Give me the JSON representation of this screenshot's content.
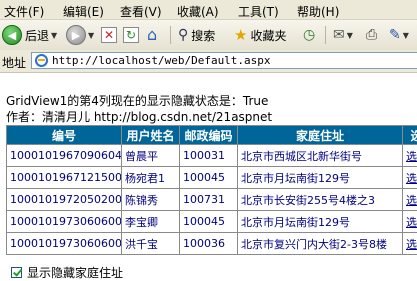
{
  "menu": {
    "items": [
      "文件(F)",
      "编辑(E)",
      "查看(V)",
      "收藏(A)",
      "工具(T)",
      "帮助(H)"
    ]
  },
  "toolbar": {
    "back_label": "后退",
    "search_label": "搜索",
    "favorites_label": "收藏夹",
    "icons": [
      "back-icon",
      "forward-icon",
      "stop-icon",
      "refresh-icon",
      "home-icon",
      "search-icon",
      "favorites-icon",
      "history-icon",
      "mail-icon",
      "print-icon"
    ]
  },
  "address": {
    "label": "地址",
    "url": "http://localhost/web/Default.aspx"
  },
  "page": {
    "status_text": "GridView1的第4列现在的显示隐藏状态是：True",
    "author_text": "作者：清清月儿 http://blog.csdn.net/21aspnet"
  },
  "grid": {
    "headers": [
      "编号",
      "用户姓名",
      "邮政编码",
      "家庭住址",
      "选"
    ],
    "rows": [
      {
        "id": "10001019670906046",
        "name": "曾晨平",
        "zip": "100031",
        "address": "北京市西城区北新华街号",
        "action": "选"
      },
      {
        "id": "10001019671215003",
        "name": "杨宛君1",
        "zip": "100045",
        "address": "北京市月坛南街129号",
        "action": "选"
      },
      {
        "id": "10001019720502000",
        "name": "陈锦秀",
        "zip": "100731",
        "address": "北京市长安街255号4楼之3",
        "action": "选"
      },
      {
        "id": "10001019730606002",
        "name": "李宝卿",
        "zip": "100045",
        "address": "北京市月坛南街129号",
        "action": "选"
      },
      {
        "id": "10001019730606003",
        "name": "洪千宝",
        "zip": "100036",
        "address": "北京市复兴门内大街2-3号8楼",
        "action": "选"
      }
    ]
  },
  "checkbox": {
    "label": "显示隐藏家庭住址",
    "checked": true
  }
}
